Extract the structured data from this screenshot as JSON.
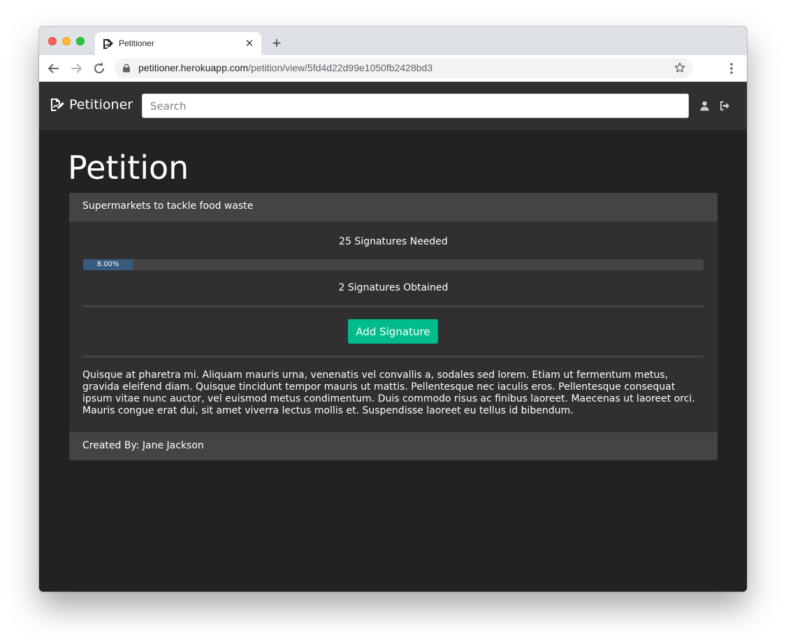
{
  "browser": {
    "tab_title": "Petitioner",
    "url_host": "petitioner.herokuapp.com",
    "url_path": "/petition/view/5fd4d22d99e1050fb2428bd3"
  },
  "navbar": {
    "brand": "Petitioner",
    "search_placeholder": "Search",
    "icons": [
      "user-icon",
      "sign-out-icon"
    ]
  },
  "page": {
    "heading": "Petition"
  },
  "petition": {
    "title": "Supermarkets to tackle food waste",
    "signatures_needed_text": "25 Signatures Needed",
    "progress_label": "8.00%",
    "progress_percent": 8,
    "signatures_obtained_text": "2 Signatures Obtained",
    "add_signature_label": "Add Signature",
    "description": "Quisque at pharetra mi. Aliquam mauris urna, venenatis vel convallis a, sodales sed lorem. Etiam ut fermentum metus, gravida eleifend diam. Quisque tincidunt tempor mauris ut mattis. Pellentesque nec iaculis eros. Pellentesque consequat ipsum vitae nunc auctor, vel euismod metus condimentum. Duis commodo risus ac finibus laoreet. Maecenas ut laoreet orci. Mauris congue erat dui, sit amet viverra lectus mollis et. Suspendisse laoreet eu tellus id bibendum.",
    "created_by": "Created By: Jane Jackson"
  },
  "colors": {
    "page_bg": "#222222",
    "navbar_bg": "#303030",
    "card_bg": "#303030",
    "card_header_bg": "#444444",
    "progress_fill": "#375a7f",
    "button_bg": "#00bc8c"
  }
}
